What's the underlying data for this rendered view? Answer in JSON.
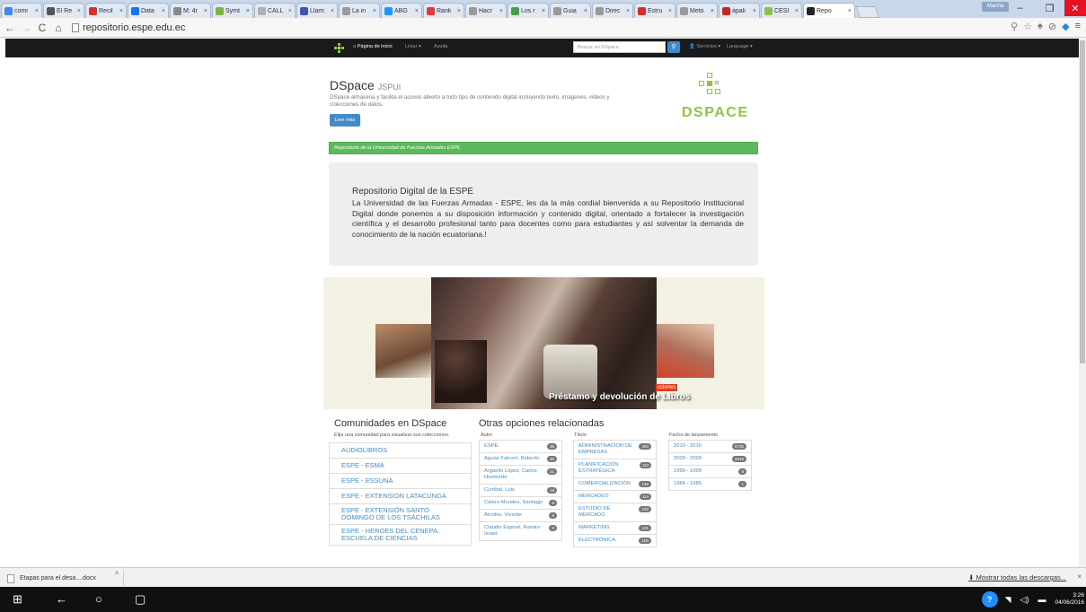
{
  "browser": {
    "tabs": [
      "comi",
      "El Re",
      "Recil",
      "Data",
      "M: 4r",
      "Symt",
      "CALL",
      "Llam:",
      "La in",
      "ABG",
      "Rank",
      "Hacr",
      "Los r",
      "Guia",
      "Direc",
      "Estru",
      "Meto",
      "apali",
      "CESI",
      "Repo"
    ],
    "user_badge": "Marina",
    "url": "repositorio.espe.edu.ec"
  },
  "navbar": {
    "home": "Página de inicio",
    "browse": "Listar",
    "help": "Ayuda",
    "search_placeholder": "Buscar en DSpace",
    "services": "Servicios",
    "language": "Language"
  },
  "hero": {
    "title": "DSpace",
    "title_sub": "JSPUI",
    "desc": "DSpace almacena y facilita el acceso abierto a todo tipo de contenido digital incluyendo texto, imágenes, videos y colecciones de datos.",
    "read_more": "Leer más",
    "logo_word": "DSPACE"
  },
  "banner_strip": "Repositorio de la Universidad de Fuerzas Armadas ESPE",
  "welcome": {
    "heading": "Repositorio Digital de la ESPE",
    "body": "La Universidad de las Fuerzas Armadas - ESPE, les da la más cordial bienvenida a su Repositorio Institucional Digital donde ponemos a su disposición información y contenido digital, orientado a fortalecer la investigación científica y el desarrollo profesional tanto para docentes como para estudiantes y así solventar la demanda de conocimiento de la nación ecuatoriana.!"
  },
  "carousel": {
    "caption": "Préstamo y devolución de Libros",
    "tag": "cciones"
  },
  "communities": {
    "title": "Comunidades en DSpace",
    "subtitle": "Elija una comunidad para visualizar sus colecciones.",
    "items": [
      "AUDIOLIBROS",
      "ESPE - ESMA",
      "ESPE - ESSUNA",
      "ESPE - EXTENSION LATACUNGA",
      "ESPE - EXTENSIÓN SANTO DOMINGO DE LOS TSÁCHILAS",
      "ESPE - HEROES DEL CENEPA: ESCUELA DE CIENCIAS"
    ]
  },
  "options": {
    "title": "Otras opciones relacionadas",
    "authors": {
      "label": "Autor",
      "items": [
        {
          "name": "ESPE",
          "count": "35"
        },
        {
          "name": "Aguiar Falconí, Roberto",
          "count": "20"
        },
        {
          "name": "Argüello López, Carlos Humberto",
          "count": "21"
        },
        {
          "name": "Cumbal, Luis",
          "count": "19"
        },
        {
          "name": "Calero Morales, Santiago",
          "count": "8"
        },
        {
          "name": "Arcolés, Vicente",
          "count": "8"
        },
        {
          "name": "Claudio Espinel, Ramiro Israel",
          "count": "8"
        }
      ]
    },
    "titles": {
      "label": "Título",
      "items": [
        {
          "name": "ADMINISTRACIÓN DE EMPRESAS",
          "count": "404"
        },
        {
          "name": "PLANIFICACIÓN ESTRATÉGICA",
          "count": "110"
        },
        {
          "name": "COMERCIALIZACIÓN",
          "count": "136"
        },
        {
          "name": "MERCADEO",
          "count": "114"
        },
        {
          "name": "ESTUDIO DE MERCADO",
          "count": "102"
        },
        {
          "name": "MARKETING",
          "count": "101"
        },
        {
          "name": "ELECTRÓNICA",
          "count": "100"
        }
      ]
    },
    "dates": {
      "label": "Fecha de lanzamiento",
      "items": [
        {
          "name": "2010 - 2016",
          "count": "6735"
        },
        {
          "name": "2000 - 2009",
          "count": "2019"
        },
        {
          "name": "1990 - 1999",
          "count": "8"
        },
        {
          "name": "1984 - 1985",
          "count": "1"
        }
      ]
    }
  },
  "downloads": {
    "item": "Etapas para el desa....docx",
    "show_all": "Mostrar todas las descargas...",
    "close": "×"
  },
  "taskbar": {
    "time": "3:26",
    "date": "04/06/2016"
  }
}
